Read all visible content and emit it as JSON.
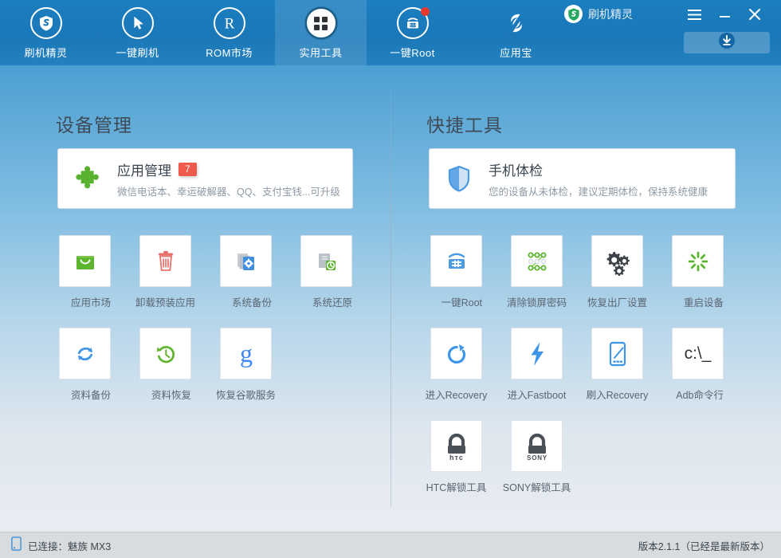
{
  "header": {
    "nav_items": [
      {
        "label": "刷机精灵",
        "icon": "shield-s-icon",
        "active": false,
        "dot": false
      },
      {
        "label": "一键刷机",
        "icon": "cursor-arrow-icon",
        "active": false,
        "dot": false
      },
      {
        "label": "ROM市场",
        "icon": "registered-r-icon",
        "active": false,
        "dot": false
      },
      {
        "label": "实用工具",
        "icon": "grid-squares-icon",
        "active": true,
        "dot": false
      },
      {
        "label": "一键Root",
        "icon": "android-root-icon",
        "active": false,
        "dot": true
      },
      {
        "label": "应用宝",
        "icon": "yingyongbao-icon",
        "active": false,
        "dot": false
      }
    ],
    "brand_name": "刷机精灵",
    "brand_logo_icon": "shield-s-logo-icon",
    "menu_icon": "hamburger-menu-icon",
    "minimize_icon": "minimize-icon",
    "close_icon": "close-icon",
    "download_icon": "download-circle-icon",
    "accent_color": "#1a78b8",
    "badge_dot_color": "#e8392f"
  },
  "left_panel": {
    "title": "设备管理",
    "card": {
      "icon": "puzzle-piece-icon",
      "title": "应用管理",
      "badge": "7",
      "subtitle": "微信电话本、幸运破解器、QQ、支付宝钱...可升级"
    },
    "tiles": [
      {
        "label": "应用市场",
        "icon": "shopping-bag-icon",
        "color": "#5cb52c"
      },
      {
        "label": "卸载预装应用",
        "icon": "trash-can-icon",
        "color": "#e8716c"
      },
      {
        "label": "系统备份",
        "icon": "files-gear-icon",
        "color": "#3f8fe0"
      },
      {
        "label": "系统还原",
        "icon": "files-restore-icon",
        "color": "#5cb52c"
      },
      {
        "label": "资料备份",
        "icon": "sync-arrows-icon",
        "color": "#3f96e8"
      },
      {
        "label": "资料恢复",
        "icon": "clock-rewind-icon",
        "color": "#63b230"
      },
      {
        "label": "恢复谷歌服务",
        "icon": "google-g-icon",
        "color": "#4285f4"
      }
    ]
  },
  "right_panel": {
    "title": "快捷工具",
    "card": {
      "icon": "shield-check-icon",
      "title": "手机体检",
      "badge": "",
      "subtitle": "您的设备从未体检，建议定期体检，保持系统健康"
    },
    "tiles": [
      {
        "label": "一键Root",
        "icon": "android-root-icon",
        "color": "#4a9ae4"
      },
      {
        "label": "清除锁屏密码",
        "icon": "pattern-lock-icon",
        "color": "#5cb52c"
      },
      {
        "label": "恢复出厂设置",
        "icon": "gears-icon",
        "color": "#3c4248"
      },
      {
        "label": "重启设备",
        "icon": "restart-burst-icon",
        "color": "#5cb52c"
      },
      {
        "label": "进入Recovery",
        "icon": "refresh-arrow-icon",
        "color": "#3f96e8"
      },
      {
        "label": "进入Fastboot",
        "icon": "lightning-bolt-icon",
        "color": "#3f96e8"
      },
      {
        "label": "刷入Recovery",
        "icon": "phone-pencil-icon",
        "color": "#3f96e8"
      },
      {
        "label": "Adb命令行",
        "icon": "command-prompt-icon",
        "color": "#2d3338",
        "text": "c:\\_"
      },
      {
        "label": "HTC解锁工具",
        "icon": "htc-padlock-icon",
        "color": "#4a5057",
        "text": "hтc"
      },
      {
        "label": "SONY解锁工具",
        "icon": "sony-padlock-icon",
        "color": "#4a5057",
        "text": "SONY"
      }
    ]
  },
  "status_bar": {
    "device_icon": "phone-icon",
    "connection_text": "已连接：魅族 MX3",
    "version_text": "版本2.1.1（已经是最新版本）"
  }
}
